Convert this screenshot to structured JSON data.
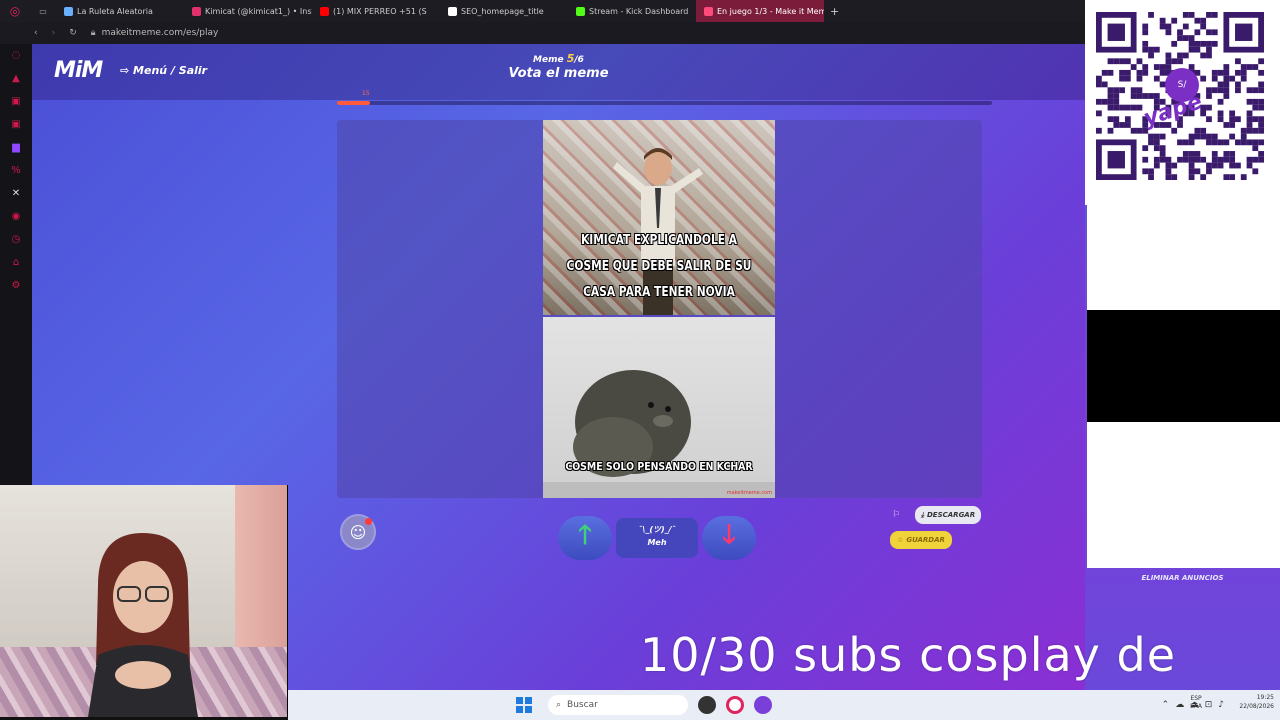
{
  "browser": {
    "tabs": [
      {
        "label": "La Ruleta Aleatoria",
        "color": "#6ab0ff"
      },
      {
        "label": "Kimicat (@kimicat1_) • Inst",
        "color": "#e1306c"
      },
      {
        "label": "(1) MIX PERREO +51 (S",
        "color": "#ff0000"
      },
      {
        "label": "SEO_homepage_title",
        "color": "#ffffff"
      },
      {
        "label": "Stream - Kick Dashboard",
        "color": "#53fc18"
      },
      {
        "label": "En juego 1/3 - Make it Mem",
        "color": "#ff4a7a"
      }
    ],
    "new_tab": "+",
    "url": "makeitmeme.com/es/play"
  },
  "sidebar": {
    "icons": [
      "opera-icon",
      "shop-icon",
      "music-icon",
      "whatsapp-icon",
      "twitch-icon",
      "x-icon",
      "history-icon",
      "clock-icon",
      "bookmark-icon",
      "settings-icon"
    ]
  },
  "header": {
    "logo": "MiM",
    "menu_link": "⇨ Menú / Salir",
    "counter_prefix": "Meme",
    "counter_current": "5",
    "counter_total": "/6",
    "title": "Vota el meme",
    "timer_label": "15",
    "timer_progress": 0.05
  },
  "meme": {
    "top_text": "KIMICAT EXPLICANDOLE A COSME QUE DEBE SALIR DE SU CASA PARA TENER NOVIA",
    "bottom_text": "COSME SOLO PENSANDO EN KCHAR",
    "watermark": "makeitmeme.com"
  },
  "actions": {
    "reaction_icon": "☺",
    "up_icon": "🡑",
    "down_icon": "🡓",
    "meh_face": "¯\\_(ツ)_/¯",
    "meh_label": "Meh",
    "report_icon": "⚐",
    "download_label": "DESCARGAR",
    "save_label": "GUARDAR"
  },
  "right_panel": {
    "qr_badge": "S/",
    "qr_brand": "yape",
    "remove_ads": "ELIMINAR ANUNCIOS"
  },
  "stream": {
    "caption": "10/30 subs cosplay de"
  },
  "taskbar": {
    "search_placeholder": "Buscar",
    "lang_top": "ESP",
    "lang_bottom": "LAA",
    "time": "19:25",
    "date": "22/08/2026"
  },
  "colors": {
    "accent": "#5867e6",
    "up": "#3ed17a",
    "down": "#ff3a6a",
    "save": "#f0d23a"
  }
}
